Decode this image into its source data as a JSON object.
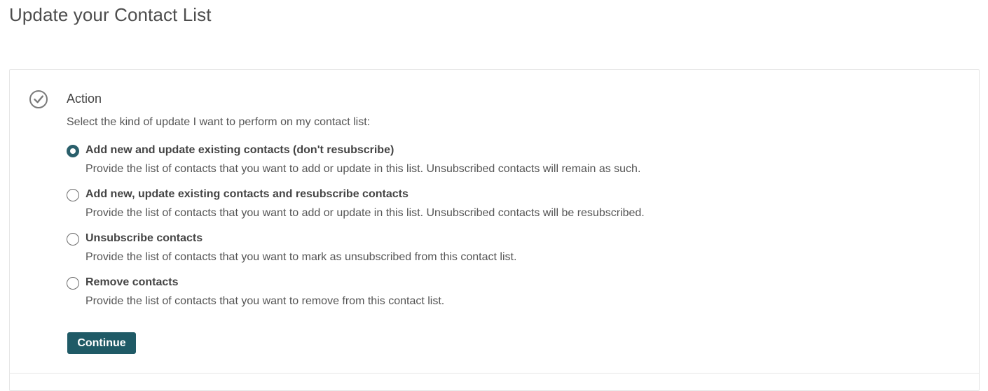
{
  "page": {
    "title": "Update your Contact List"
  },
  "step": {
    "icon": "check-circle-icon",
    "title": "Action",
    "intro": "Select the kind of update I want to perform on my contact list:"
  },
  "options": [
    {
      "label": "Add new and update existing contacts (don't resubscribe)",
      "description": "Provide the list of contacts that you want to add or update in this list. Unsubscribed contacts will remain as such.",
      "selected": true
    },
    {
      "label": "Add new, update existing contacts and resubscribe contacts",
      "description": "Provide the list of contacts that you want to add or update in this list. Unsubscribed contacts will be resubscribed.",
      "selected": false
    },
    {
      "label": "Unsubscribe contacts",
      "description": "Provide the list of contacts that you want to mark as unsubscribed from this contact list.",
      "selected": false
    },
    {
      "label": "Remove contacts",
      "description": "Provide the list of contacts that you want to remove from this contact list.",
      "selected": false
    }
  ],
  "actions": {
    "continue_label": "Continue"
  },
  "colors": {
    "accent": "#1f5a66",
    "text": "#555555",
    "border": "#e6e6e6"
  }
}
